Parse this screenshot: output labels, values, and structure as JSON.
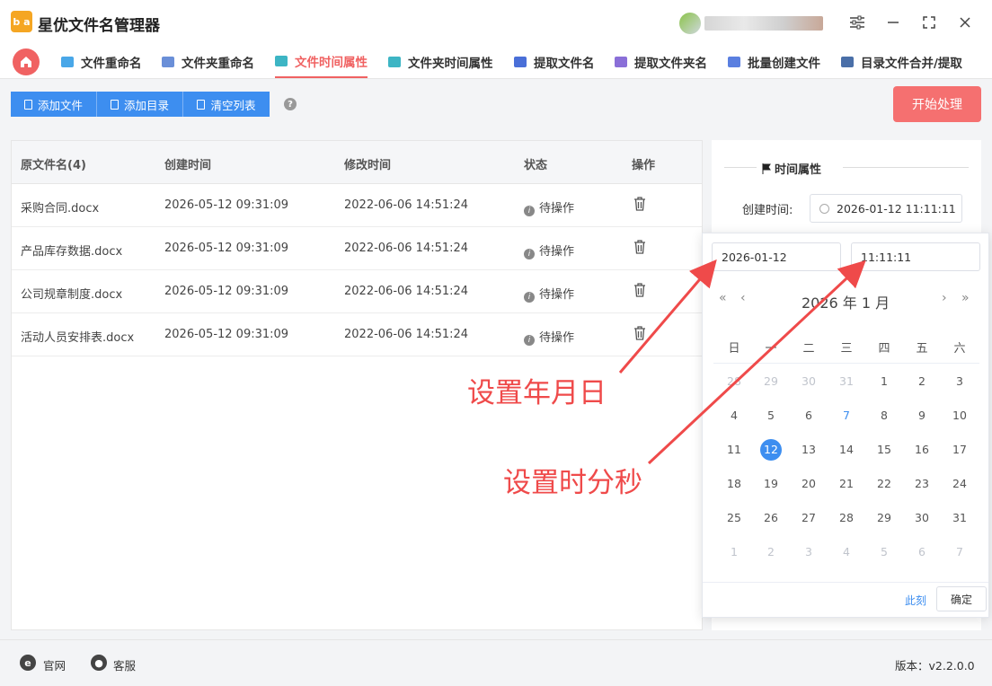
{
  "app": {
    "title": "星优文件名管理器",
    "logo_text": "b a"
  },
  "nav": {
    "tabs": [
      {
        "label": "文件重命名",
        "color": "#49a7e8"
      },
      {
        "label": "文件夹重命名",
        "color": "#6a8fd8"
      },
      {
        "label": "文件时间属性",
        "color": "#3db5c4"
      },
      {
        "label": "文件夹时间属性",
        "color": "#3db5c4"
      },
      {
        "label": "提取文件名",
        "color": "#4a6fd8"
      },
      {
        "label": "提取文件夹名",
        "color": "#8a6fd8"
      },
      {
        "label": "批量创建文件",
        "color": "#5a7fe0"
      },
      {
        "label": "目录文件合并/提取",
        "color": "#4a6fa8"
      }
    ],
    "active_index": 2
  },
  "toolbar": {
    "add_file": "添加文件",
    "add_dir": "添加目录",
    "clear_list": "清空列表",
    "help": "?",
    "start": "开始处理"
  },
  "table": {
    "headers": [
      "原文件名(4)",
      "创建时间",
      "修改时间",
      "状态",
      "操作"
    ],
    "rows": [
      {
        "name": "采购合同.docx",
        "created": "2026-05-12 09:31:09",
        "modified": "2022-06-06 14:51:24",
        "status": "待操作"
      },
      {
        "name": "产品库存数据.docx",
        "created": "2026-05-12 09:31:09",
        "modified": "2022-06-06 14:51:24",
        "status": "待操作"
      },
      {
        "name": "公司规章制度.docx",
        "created": "2026-05-12 09:31:09",
        "modified": "2022-06-06 14:51:24",
        "status": "待操作"
      },
      {
        "name": "活动人员安排表.docx",
        "created": "2026-05-12 09:31:09",
        "modified": "2022-06-06 14:51:24",
        "status": "待操作"
      }
    ]
  },
  "side": {
    "section_title": "时间属性",
    "create_label": "创建时间:",
    "create_value": "2026-01-12 11:11:11"
  },
  "picker": {
    "date_value": "2026-01-12",
    "time_value": "11:11:11",
    "header": "2026 年  1 月",
    "prev_year": "«",
    "prev_month": "‹",
    "next_month": "›",
    "next_year": "»",
    "weekdays": [
      "日",
      "一",
      "二",
      "三",
      "四",
      "五",
      "六"
    ],
    "weeks": [
      [
        "28",
        "29",
        "30",
        "31",
        "1",
        "2",
        "3"
      ],
      [
        "4",
        "5",
        "6",
        "7",
        "8",
        "9",
        "10"
      ],
      [
        "11",
        "12",
        "13",
        "14",
        "15",
        "16",
        "17"
      ],
      [
        "18",
        "19",
        "20",
        "21",
        "22",
        "23",
        "24"
      ],
      [
        "25",
        "26",
        "27",
        "28",
        "29",
        "30",
        "31"
      ],
      [
        "1",
        "2",
        "3",
        "4",
        "5",
        "6",
        "7"
      ]
    ],
    "now_label": "此刻",
    "ok_label": "确定"
  },
  "annotations": {
    "date": "设置年月日",
    "time": "设置时分秒",
    "color": "#ef4a4a"
  },
  "footer": {
    "website": "官网",
    "support": "客服",
    "version": "版本：v2.2.0.0"
  }
}
